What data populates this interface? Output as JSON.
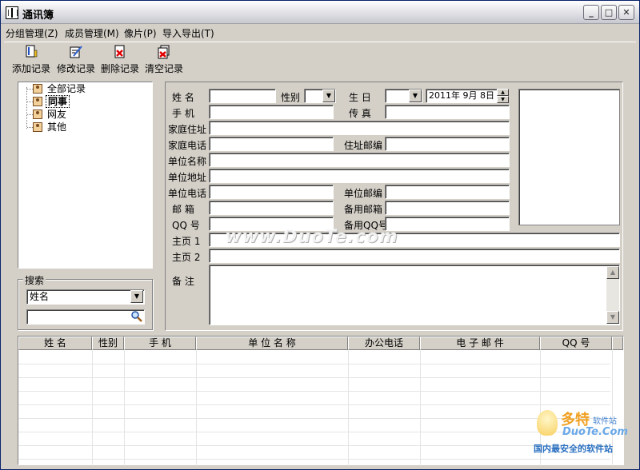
{
  "window": {
    "title": "通讯簿",
    "min": "_",
    "max": "□",
    "close": "✕"
  },
  "menu": [
    {
      "label": "分组管理(Z)"
    },
    {
      "label": "成员管理(M)"
    },
    {
      "label": "像片(P)"
    },
    {
      "label": "导入导出(T)"
    }
  ],
  "toolbar": [
    {
      "label": "添加记录",
      "icon": "add-record-icon"
    },
    {
      "label": "修改记录",
      "icon": "edit-record-icon"
    },
    {
      "label": "删除记录",
      "icon": "delete-record-icon"
    },
    {
      "label": "清空记录",
      "icon": "clear-record-icon"
    }
  ],
  "tree": {
    "items": [
      {
        "label": "全部记录"
      },
      {
        "label": "同事",
        "selected": true
      },
      {
        "label": "网友"
      },
      {
        "label": "其他"
      }
    ]
  },
  "search": {
    "title": "搜索",
    "field_value": "姓名",
    "query": ""
  },
  "form": {
    "name": "姓  名",
    "gender": "性别",
    "birthday": "生  日",
    "birthday_value": "2011年 9月 8日",
    "mobile": "手  机",
    "fax": "传  真",
    "home_address": "家庭住址",
    "home_phone": "家庭电话",
    "home_zip": "住址邮编",
    "company_name": "单位名称",
    "company_address": "单位地址",
    "company_phone": "单位电话",
    "company_zip": "单位邮编",
    "email": "邮  箱",
    "backup_email": "备用邮箱",
    "qq": "QQ  号",
    "backup_qq": "备用QQ号",
    "homepage1": "主页 1",
    "homepage2": "主页 2",
    "notes": "备  注"
  },
  "grid": {
    "columns": [
      "姓  名",
      "性别",
      "手  机",
      "单 位 名 称",
      "办公电话",
      "电 子 邮 件",
      "QQ 号"
    ]
  },
  "watermark": "www.DuoTe.com",
  "corner_logo": {
    "title": "多特",
    "subtitle": "软件站",
    "url": "DuoTe.Com",
    "tagline": "国内最安全的软件站"
  }
}
